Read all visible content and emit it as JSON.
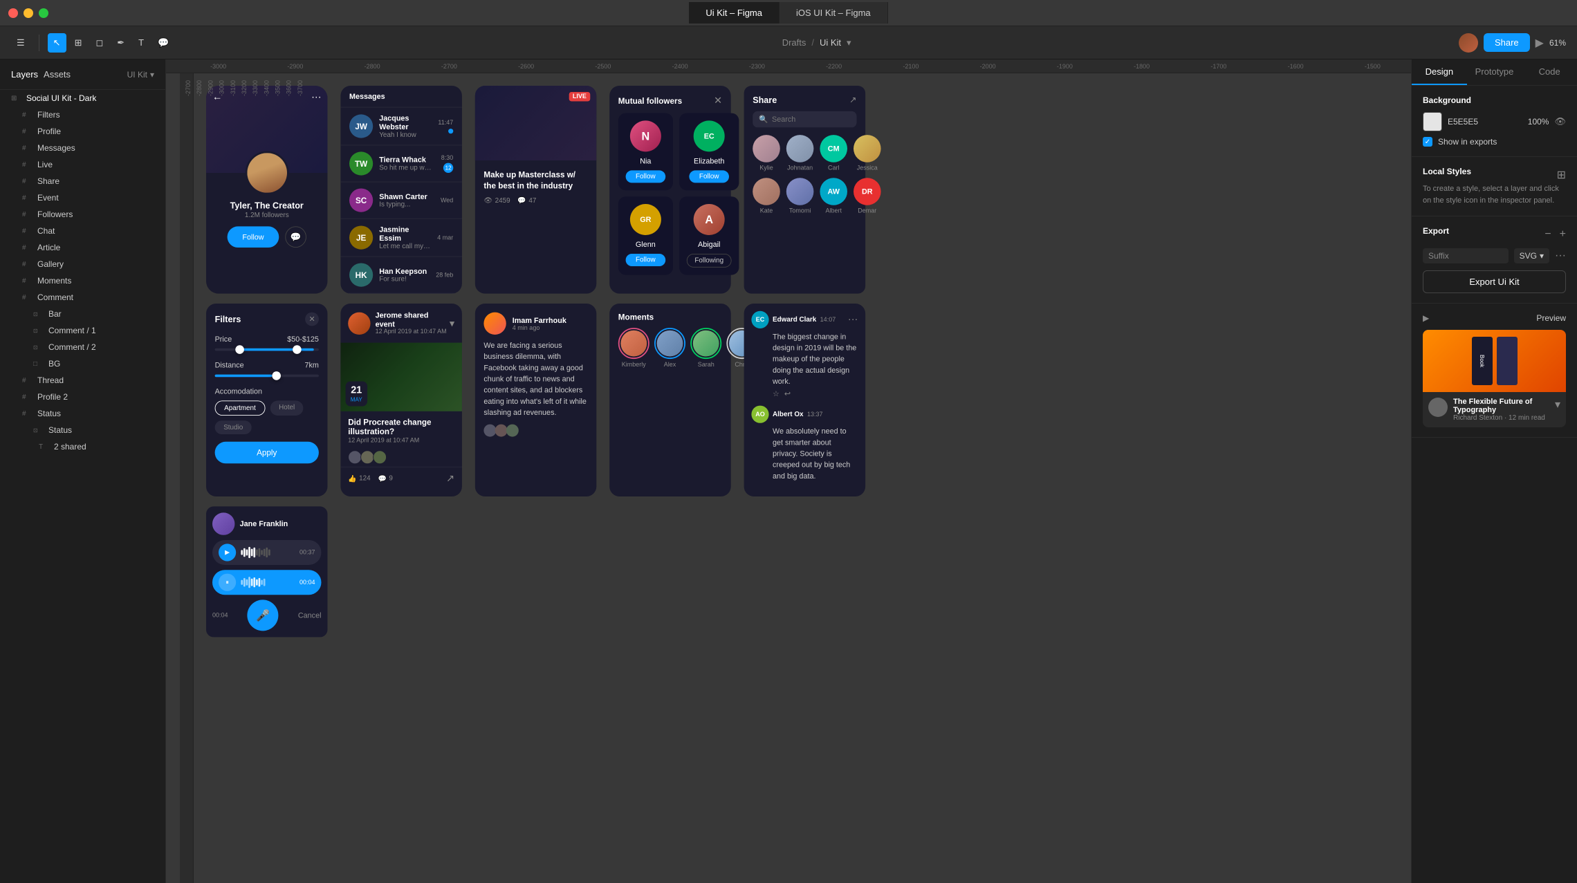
{
  "titlebar": {
    "tab1": "Ui Kit – Figma",
    "tab2": "iOS UI Kit – Figma",
    "controls": [
      "close",
      "minimize",
      "maximize"
    ]
  },
  "toolbar": {
    "menu_icon": "☰",
    "path_label": "Drafts",
    "separator": "/",
    "file_label": "Ui Kit",
    "share_btn": "Share",
    "zoom": "61%"
  },
  "left_panel": {
    "tab_layers": "Layers",
    "tab_assets": "Assets",
    "ui_kit_label": "UI Kit",
    "items": [
      {
        "name": "Social UI Kit - Dark",
        "type": "group",
        "indent": 0
      },
      {
        "name": "Filters",
        "type": "layer",
        "indent": 1
      },
      {
        "name": "Profile",
        "type": "layer",
        "indent": 1
      },
      {
        "name": "Messages",
        "type": "layer",
        "indent": 1
      },
      {
        "name": "Live",
        "type": "layer",
        "indent": 1
      },
      {
        "name": "Share",
        "type": "layer",
        "indent": 1
      },
      {
        "name": "Event",
        "type": "layer",
        "indent": 1
      },
      {
        "name": "Followers",
        "type": "layer",
        "indent": 1
      },
      {
        "name": "Chat",
        "type": "layer",
        "indent": 1
      },
      {
        "name": "Article",
        "type": "layer",
        "indent": 1
      },
      {
        "name": "Gallery",
        "type": "layer",
        "indent": 1
      },
      {
        "name": "Moments",
        "type": "layer",
        "indent": 1
      },
      {
        "name": "Comment",
        "type": "layer",
        "indent": 1
      },
      {
        "name": "Bar",
        "type": "sub",
        "indent": 2
      },
      {
        "name": "Comment / 1",
        "type": "sub",
        "indent": 2
      },
      {
        "name": "Comment / 2",
        "type": "sub",
        "indent": 2
      },
      {
        "name": "BG",
        "type": "sub",
        "indent": 2
      },
      {
        "name": "Thread",
        "type": "layer",
        "indent": 1
      },
      {
        "name": "Profile 2",
        "type": "layer",
        "indent": 1
      },
      {
        "name": "Status",
        "type": "layer",
        "indent": 1
      },
      {
        "name": "Status",
        "type": "sub",
        "indent": 2
      },
      {
        "name": "2 shared",
        "type": "sub2",
        "indent": 3
      }
    ]
  },
  "ruler": {
    "labels": [
      "-3000",
      "-2900",
      "-2800",
      "-2700",
      "-2600",
      "-2500",
      "-2400",
      "-2300",
      "-2200",
      "-2100",
      "-2000",
      "-1900",
      "-1800",
      "-1700",
      "-1600",
      "-1500"
    ]
  },
  "right_panel": {
    "tab_design": "Design",
    "tab_prototype": "Prototype",
    "tab_code": "Code",
    "background": {
      "label": "Background",
      "color": "#E5E5E5",
      "color_display": "E5E5E5",
      "opacity": "100%",
      "show_exports_label": "Show in exports"
    },
    "local_styles": {
      "label": "Local Styles",
      "description": "To create a style, select a layer and click on the style icon in the inspector panel."
    },
    "export": {
      "label": "Export",
      "suffix_label": "Suffix",
      "format": "SVG",
      "button": "Export Ui Kit"
    },
    "preview": {
      "label": "Preview",
      "article_title": "The Flexible Future of Typography",
      "article_author": "Richard Stexton",
      "article_read": "12 min read"
    },
    "avatars": [
      {
        "name": "Kylie",
        "color": "#c8a8b0"
      },
      {
        "name": "Johnatan",
        "color": "#a8b8c8"
      },
      {
        "name": "Carl",
        "color": "#00c8a0",
        "initials": "CM"
      },
      {
        "name": "Jessica",
        "color": "#d8a020"
      }
    ],
    "avatars2": [
      {
        "name": "Kate",
        "color": "#c89080"
      },
      {
        "name": "Tomomi",
        "color": "#8890c8"
      },
      {
        "name": "Albert",
        "color": "#00a8c8",
        "initials": "AW"
      },
      {
        "name": "Demar",
        "color": "#e83030",
        "initials": "DR"
      }
    ]
  },
  "canvas": {
    "profile_card": {
      "name": "Tyler, The Creator",
      "followers": "1.2M followers",
      "follow_btn": "Follow"
    },
    "chat_messages": [
      {
        "name": "Jacques Webster",
        "time": "11:47",
        "msg": "Yeah I know",
        "color": "#2a5a8a",
        "initials": "JW"
      },
      {
        "name": "Tierra Whack",
        "time": "8:30",
        "msg": "So hit me up when you're...",
        "color": "#2a8a2a",
        "initials": "TW",
        "badge": "12"
      },
      {
        "name": "Shawn Carter",
        "time": "Wed",
        "msg": "Is typing...",
        "color": "#8a2a8a",
        "initials": "SC"
      },
      {
        "name": "Jasmine Essim",
        "time": "4 mar",
        "msg": "Let me call my agency",
        "color": "#8a6a00",
        "initials": "JE"
      },
      {
        "name": "Han Keepson",
        "time": "28 feb",
        "msg": "For sure!",
        "color": "#2a6a6a",
        "initials": "HK"
      }
    ],
    "filters": {
      "title": "Filters",
      "price_label": "Price",
      "price_value": "$50-$125",
      "distance_label": "Distance",
      "distance_value": "7km",
      "accommodation_label": "Accomodation",
      "chips": [
        "Apartment",
        "Hotel",
        "Studio"
      ],
      "active_chip": "Apartment",
      "apply_btn": "Apply"
    },
    "live": {
      "badge": "LIVE",
      "title": "Make up Masterclass w/ the best in the industry",
      "views": "2459",
      "comments": "47"
    },
    "mutual_followers": {
      "title": "Mutual followers",
      "people": [
        {
          "name": "Nia",
          "color": "#e05080",
          "initials": "N",
          "btn": "Follow"
        },
        {
          "name": "Elizabeth",
          "color": "#00b060",
          "initials": "EC",
          "btn": "Follow"
        },
        {
          "name": "Glenn",
          "color": "#d4a000",
          "initials": "GR",
          "btn": "Follow"
        },
        {
          "name": "Abigail",
          "color": "#c87060",
          "initials": "A",
          "btn": "Following"
        }
      ]
    },
    "event": {
      "user": "Jerome shared event",
      "date": "12 April 2019 at 10:47 AM",
      "day": "21",
      "month": "May",
      "title": "Did Procreate change illustration?",
      "subtitle": "12 April 2019 at 10:47 AM",
      "likes": "124",
      "comments": "9"
    },
    "thread": {
      "user": "Imam Farrhouk",
      "time": "4 min ago",
      "text": "We are facing a serious business dilemma, with Facebook taking away a good chunk of traffic to news and content sites, and ad blockers eating into what's left of it while slashing ad revenues."
    },
    "moments": {
      "title": "Moments",
      "people": [
        "Kimberly",
        "Alex",
        "Sarah",
        "Chris"
      ]
    },
    "chat_detail": [
      {
        "name": "Edward Clark",
        "time": "14:07",
        "msg": "The biggest change in design in 2019 will be the makeup of the people doing the actual design work.",
        "initials": "EC",
        "color": "#00a0c0"
      },
      {
        "name": "Albert Ox",
        "time": "13:37",
        "msg": "We absolutely need to get smarter about privacy. Society is creeped out by big tech and big data.",
        "initials": "AO",
        "color": "#88c030"
      }
    ],
    "share_panel": {
      "title": "Share",
      "search_placeholder": "Search"
    }
  }
}
